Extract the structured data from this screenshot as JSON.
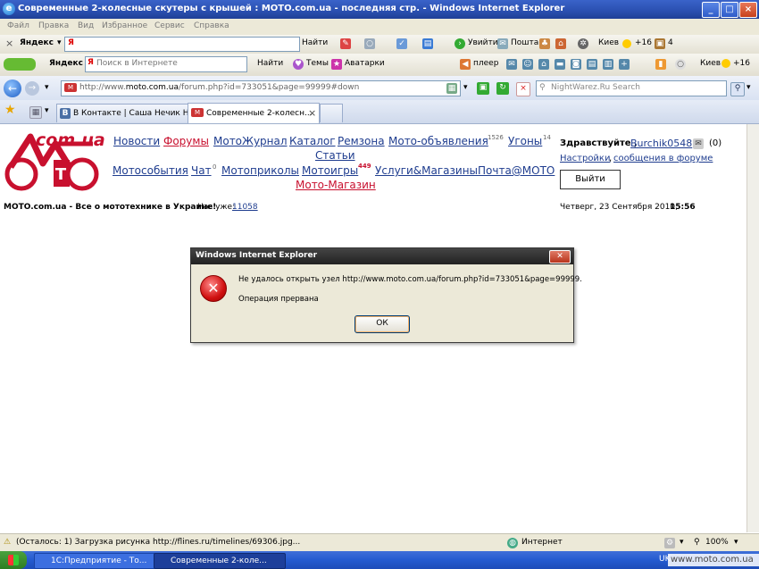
{
  "window": {
    "title": "Современные 2-колесные скутеры с крышей : MOTO.com.ua - последняя стр. - Windows Internet Explorer",
    "min": "_",
    "max": "□",
    "close": "×"
  },
  "menu": [
    "Файл",
    "Правка",
    "Вид",
    "Избранное",
    "Сервис",
    "Справка"
  ],
  "toolbar1": {
    "brand": "Яндекс",
    "search_value": "Я",
    "find": "Найти",
    "uvity": "Увийти",
    "mail": "Пошта",
    "city": "Киев",
    "temp": "+16",
    "count": "4"
  },
  "toolbar2": {
    "brand": "Яндекс",
    "search_placeholder": "Поиск в Интернете",
    "find": "Найти",
    "themes": "Темы",
    "avatars": "Аватарки",
    "player": "плеер",
    "city": "Киев",
    "temp": "+16"
  },
  "address": {
    "url_prefix": "http://www.",
    "url_domain": "moto.com.ua",
    "url_rest": "/forum.php?id=733051&page=99999#down",
    "search_placeholder": "NightWarez.Ru Search"
  },
  "tabs": [
    {
      "label": "В Контакте | Саша Нечик Н..."
    },
    {
      "label": "Современные 2-колесн..."
    }
  ],
  "site": {
    "logo_text": "com.ua",
    "nav_row1": [
      {
        "label": "Новости",
        "sup": ""
      },
      {
        "label": "Форумы",
        "sup": ""
      },
      {
        "label": "МотоЖурнал",
        "sup": ""
      },
      {
        "label": "Каталог",
        "sup": ""
      },
      {
        "label": "Ремзона",
        "sup": ""
      },
      {
        "label": "Мото-объявления",
        "sup": "1526"
      },
      {
        "label": "Угоны",
        "sup": "14"
      }
    ],
    "nav_row1b": "Статьи",
    "nav_row2": [
      {
        "label": "Мотособытия",
        "sup": ""
      },
      {
        "label": "Чат",
        "sup": "0"
      },
      {
        "label": "Мотоприколы",
        "sup": ""
      },
      {
        "label": "Мотоигры",
        "sup": "449"
      },
      {
        "label": "Услуги&Магазины",
        "sup": ""
      },
      {
        "label": "Почта@MOTO",
        "sup": ""
      }
    ],
    "shop": "Мото-Магазин",
    "greeting": "Здравствуйте ,",
    "username": "Burchik0548",
    "msg_count": "(0)",
    "settings": "Настройки",
    "forum_msgs": "сообщения в форуме",
    "logout": "Выйти",
    "tagline": "MOTO.com.ua - Все о мототехнике в Украине!",
    "members_label": "Нас уже:",
    "members_count": "11058",
    "date": "Четверг, 23 Сентября 2010,",
    "time": "15:56"
  },
  "dialog": {
    "title": "Windows Internet Explorer",
    "message": "Не удалось открыть узел http://www.moto.com.ua/forum.php?id=733051&page=99999.",
    "sub": "Операция прервана",
    "ok": "ОК"
  },
  "status": {
    "text": "(Осталось: 1) Загрузка рисунка http://flines.ru/timelines/69306.jpg...",
    "zone": "Интернет",
    "zoom": "100%"
  },
  "taskbar": {
    "tasks": [
      "1С:Предприятие - То...",
      "Современные 2-коле..."
    ],
    "lang": "UK",
    "watermark": "www.moto.com.ua"
  }
}
